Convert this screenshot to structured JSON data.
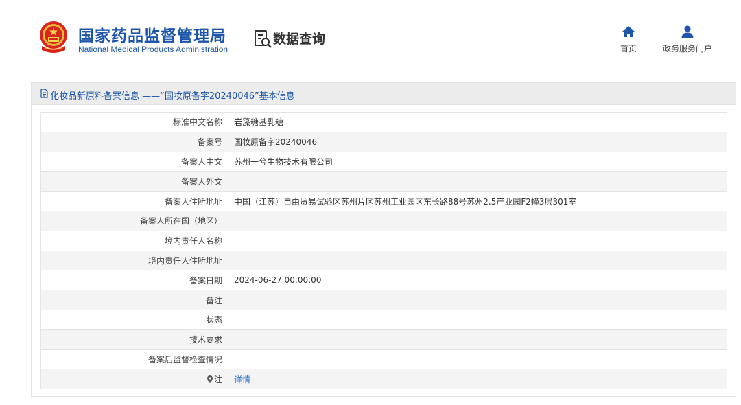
{
  "header": {
    "org_name_cn": "国家药品监督管理局",
    "org_name_en": "National Medical Products Administration",
    "query_title": "数据查询",
    "nav": [
      {
        "label": "首页",
        "icon": "home-icon"
      },
      {
        "label": "政务服务门户",
        "icon": "user-icon"
      }
    ]
  },
  "panel": {
    "title": "化妆品新原料备案信息 ——“国妆原备字20240046”基本信息",
    "rows": [
      {
        "label": "标准中文名称",
        "value": "岩藻糖基乳糖"
      },
      {
        "label": "备案号",
        "value": "国妆原备字20240046"
      },
      {
        "label": "备案人中文",
        "value": "苏州一兮生物技术有限公司"
      },
      {
        "label": "备案人外文",
        "value": ""
      },
      {
        "label": "备案人住所地址",
        "value": "中国（江苏）自由贸易试验区苏州片区苏州工业园区东长路88号苏州2.5产业园F2幢3层301室"
      },
      {
        "label": "备案人所在国（地区）",
        "value": ""
      },
      {
        "label": "境内责任人名称",
        "value": ""
      },
      {
        "label": "境内责任人住所地址",
        "value": ""
      },
      {
        "label": "备案日期",
        "value": "2024-06-27 00:00:00"
      },
      {
        "label": "备注",
        "value": ""
      },
      {
        "label": "状态",
        "value": ""
      },
      {
        "label": "技术要求",
        "value": ""
      },
      {
        "label": "备案后监督检查情况",
        "value": ""
      }
    ],
    "note_label": "注",
    "note_link": "详情"
  },
  "colors": {
    "brand_blue": "#1d56a8",
    "link_blue": "#3a78c8"
  }
}
